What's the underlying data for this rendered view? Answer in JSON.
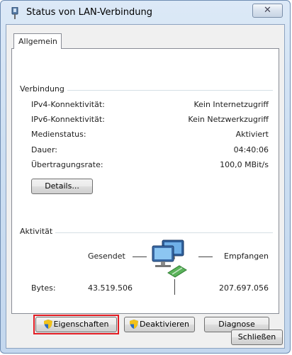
{
  "window": {
    "title": "Status von LAN-Verbindung",
    "close_symbol": "✕"
  },
  "tabs": [
    {
      "label": "Allgemein"
    }
  ],
  "connection": {
    "group_label": "Verbindung",
    "rows": [
      {
        "label": "IPv4-Konnektivität:",
        "value": "Kein Internetzugriff"
      },
      {
        "label": "IPv6-Konnektivität:",
        "value": "Kein Netzwerkzugriff"
      },
      {
        "label": "Medienstatus:",
        "value": "Aktiviert"
      },
      {
        "label": "Dauer:",
        "value": "04:40:06"
      },
      {
        "label": "Übertragungsrate:",
        "value": "100,0 MBit/s"
      }
    ],
    "details_button": "Details..."
  },
  "activity": {
    "group_label": "Aktivität",
    "sent_label": "Gesendet",
    "received_label": "Empfangen",
    "bytes_label": "Bytes:",
    "bytes_sent": "43.519.506",
    "bytes_received": "207.697.056"
  },
  "actions": {
    "properties_button": "Eigenschaften",
    "deactivate_button": "Deaktivieren",
    "diagnose_button": "Diagnose",
    "highlight_color": "#e21d24"
  },
  "footer": {
    "close_button": "Schließen"
  },
  "icons": {
    "title": "network-adapter-icon",
    "activity": "network-computers-icon",
    "button_shield": "uac-shield-icon"
  }
}
